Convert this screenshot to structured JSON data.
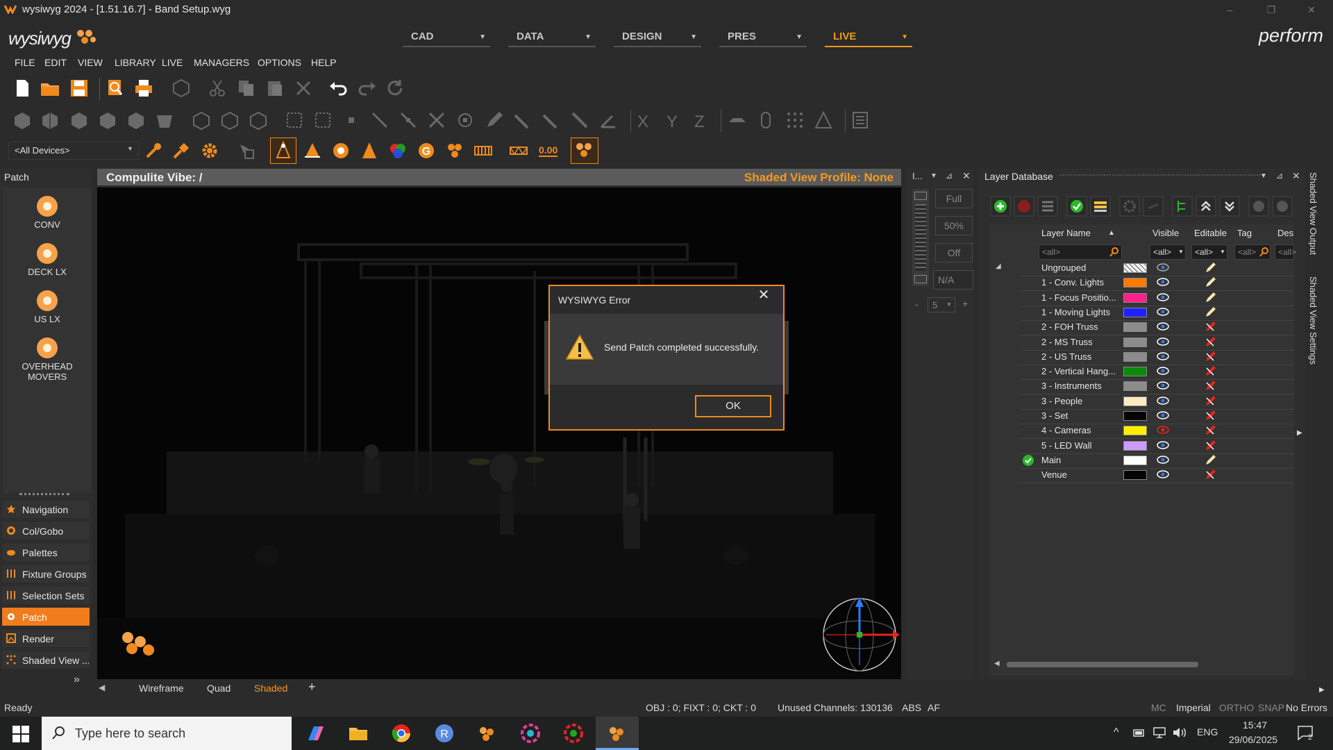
{
  "window": {
    "title": "wysiwyg 2024 - [1.51.16.7] - Band Setup.wyg",
    "logo": "wysiwyg",
    "brand_right": "perform",
    "minimize": "–",
    "restore": "❐",
    "close": "✕"
  },
  "mode_tabs": [
    {
      "label": "CAD",
      "arrow": "▼"
    },
    {
      "label": "DATA",
      "arrow": "▼"
    },
    {
      "label": "DESIGN",
      "arrow": "▼"
    },
    {
      "label": "PRES",
      "arrow": "▼"
    },
    {
      "label": "LIVE",
      "arrow": "▼",
      "active": true
    }
  ],
  "menu": [
    "FILE",
    "EDIT",
    "VIEW",
    "LIBRARY",
    "LIVE",
    "MANAGERS",
    "OPTIONS",
    "HELP"
  ],
  "toolbar": {
    "device_filter": "<All Devices>",
    "axis_labels": [
      "X",
      "Y",
      "Z"
    ],
    "value_readout": "0.00"
  },
  "left_panel": {
    "title": "Patch",
    "universes": [
      {
        "label": "CONV"
      },
      {
        "label": "DECK LX"
      },
      {
        "label": "US LX"
      },
      {
        "label": "OVERHEAD MOVERS"
      }
    ],
    "nav": [
      {
        "label": "Navigation",
        "icon": "star-icon"
      },
      {
        "label": "Col/Gobo",
        "icon": "gobo-icon"
      },
      {
        "label": "Palettes",
        "icon": "palette-icon"
      },
      {
        "label": "Fixture Groups",
        "icon": "fixture-groups-icon"
      },
      {
        "label": "Selection Sets",
        "icon": "selection-sets-icon"
      },
      {
        "label": "Patch",
        "icon": "patch-icon",
        "active": true
      },
      {
        "label": "Render",
        "icon": "render-icon"
      },
      {
        "label": "Shaded View ...",
        "icon": "shaded-view-icon"
      }
    ],
    "more": "»"
  },
  "viewport": {
    "title": "Compulite Vibe: /",
    "profile": "Shaded View Profile: None",
    "tabs": [
      "Wireframe",
      "Quad",
      "Shaded",
      "+"
    ],
    "active_tab": "Shaded",
    "scroll_left": "◀"
  },
  "mid_panel": {
    "title": "I...",
    "buttons": [
      "Full",
      "50%",
      "Off",
      "N/A"
    ],
    "minus": "-",
    "stepper_value": "5",
    "plus": "+"
  },
  "layer_db": {
    "title": "Layer Database",
    "columns": [
      "Layer Name",
      "Visible",
      "Editable",
      "Tag",
      "Des"
    ],
    "filters": [
      "<all>",
      "<all>",
      "<all>",
      "<all>",
      "<all>"
    ],
    "rows": [
      {
        "name": "Ungrouped",
        "color": "#e8e8e8",
        "pattern": true,
        "editable": true,
        "current": false
      },
      {
        "name": "1 - Conv. Lights",
        "color": "#ff7a00",
        "editable": true,
        "current": false
      },
      {
        "name": "1 - Focus Positio...",
        "color": "#ff1f8c",
        "editable": true,
        "current": false
      },
      {
        "name": "1 - Moving Lights",
        "color": "#1f22ff",
        "editable": true,
        "current": false
      },
      {
        "name": "2 - FOH Truss",
        "color": "#8c8c8c",
        "editable": false,
        "current": false
      },
      {
        "name": "2 - MS Truss",
        "color": "#8c8c8c",
        "editable": false,
        "current": false
      },
      {
        "name": "2 - US Truss",
        "color": "#8c8c8c",
        "editable": false,
        "current": false
      },
      {
        "name": "2 - Vertical Hang...",
        "color": "#0b8a0b",
        "editable": false,
        "current": false
      },
      {
        "name": "3 - Instruments",
        "color": "#8c8c8c",
        "editable": false,
        "current": false
      },
      {
        "name": "3 - People",
        "color": "#ffe8c4",
        "editable": false,
        "current": false
      },
      {
        "name": "3 - Set",
        "color": "#050505",
        "editable": false,
        "current": false
      },
      {
        "name": "4 - Cameras",
        "color": "#ffee00",
        "editable": false,
        "current": false,
        "hidden": true
      },
      {
        "name": "5 - LED Wall",
        "color": "#cf9aff",
        "editable": false,
        "current": false
      },
      {
        "name": "Main",
        "color": "#ffffff",
        "editable": true,
        "current": true
      },
      {
        "name": "Venue",
        "color": "#050505",
        "editable": false,
        "current": false
      }
    ]
  },
  "side_tabs": [
    "Shaded View Output",
    "Shaded View Settings"
  ],
  "status": {
    "left": "Ready",
    "obj": "OBJ : 0; FIXT : 0; CKT : 0",
    "channels": "Unused Channels: 130136",
    "abs": "ABS",
    "af": "AF",
    "mc": "MC",
    "units": "Imperial",
    "ortho": "ORTHO",
    "snap": "SNAP",
    "errors": "No Errors"
  },
  "taskbar": {
    "search_placeholder": "Type here to search",
    "lang": "ENG",
    "time": "15:47",
    "date": "29/06/2025",
    "notif_count": "2"
  },
  "dialog": {
    "title": "WYSIWYG Error",
    "message": "Send Patch completed successfully.",
    "ok_label": "OK",
    "close": "✕"
  },
  "colors": {
    "accent": "#f08a1e",
    "profile_text": "#f39a1e"
  }
}
